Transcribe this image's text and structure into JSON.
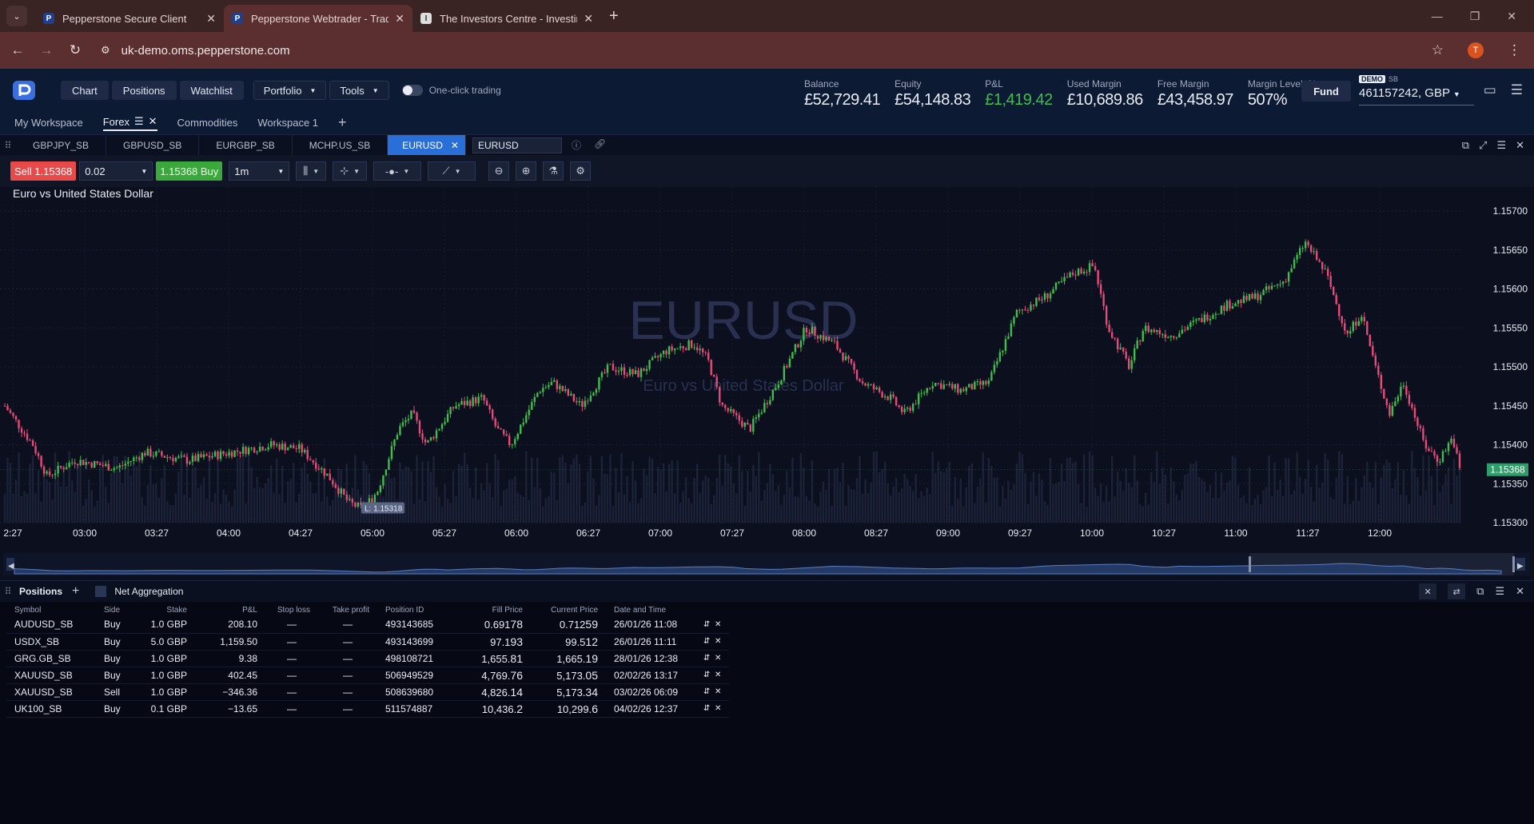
{
  "browser": {
    "tabs": [
      {
        "title": "Pepperstone Secure Client",
        "favicon": "P",
        "active": false
      },
      {
        "title": "Pepperstone Webtrader - Trade",
        "favicon": "P",
        "active": true
      },
      {
        "title": "The Investors Centre - Investing",
        "favicon": "I",
        "active": false
      }
    ],
    "url": "uk-demo.oms.pepperstone.com",
    "avatar_letter": "T"
  },
  "header": {
    "buttons": [
      "Chart",
      "Positions",
      "Watchlist"
    ],
    "selects": [
      "Portfolio",
      "Tools"
    ],
    "one_click_label": "One-click trading",
    "metrics": [
      {
        "label": "Balance",
        "value": "£52,729.41",
        "color": "#e8ecf4"
      },
      {
        "label": "Equity",
        "value": "£54,148.83",
        "color": "#e8ecf4"
      },
      {
        "label": "P&L",
        "value": "£1,419.42",
        "color": "#3fbf4a"
      },
      {
        "label": "Used Margin",
        "value": "£10,689.86",
        "color": "#e8ecf4"
      },
      {
        "label": "Free Margin",
        "value": "£43,458.97",
        "color": "#e8ecf4"
      },
      {
        "label": "Margin Level, %",
        "value": "507%",
        "color": "#e8ecf4"
      }
    ],
    "fund_label": "Fund",
    "account": {
      "badge": "DEMO",
      "type": "SB",
      "number": "461157242, GBP"
    }
  },
  "workspaces": [
    {
      "label": "My Workspace",
      "active": false
    },
    {
      "label": "Forex",
      "active": true
    },
    {
      "label": "Commodities",
      "active": false
    },
    {
      "label": "Workspace 1",
      "active": false
    }
  ],
  "symbol_tabs": [
    "GBPJPY_SB",
    "GBPUSD_SB",
    "EURGBP_SB",
    "MCHP.US_SB"
  ],
  "active_symbol": "EURUSD",
  "symbol_search_value": "EURUSD",
  "toolbar": {
    "sell_label": "Sell 1.15368",
    "quantity": "0.02",
    "buy_label": "1.15368 Buy",
    "timeframe": "1m"
  },
  "chart": {
    "title": "Euro vs United States Dollar",
    "watermark_symbol": "EURUSD",
    "watermark_name": "Euro vs United States Dollar",
    "low_label": "L: 1.15318",
    "current_price": "1.15368",
    "up_color": "#3fbf4a",
    "down_color": "#e84a7a"
  },
  "chart_data": {
    "type": "candlestick",
    "title": "Euro vs United States Dollar",
    "x_ticks": [
      "2:27",
      "03:00",
      "03:27",
      "04:00",
      "04:27",
      "05:00",
      "05:27",
      "06:00",
      "06:27",
      "07:00",
      "07:27",
      "08:00",
      "08:27",
      "09:00",
      "09:27",
      "10:00",
      "10:27",
      "11:00",
      "11:27",
      "12:00"
    ],
    "y_ticks": [
      "1.15700",
      "1.15650",
      "1.15600",
      "1.15550",
      "1.15500",
      "1.15450",
      "1.15400",
      "1.15350",
      "1.15300"
    ],
    "ylim": [
      1.153,
      1.157
    ],
    "path_points": [
      [
        0,
        1.1545
      ],
      [
        0.02,
        1.154
      ],
      [
        0.03,
        1.1536
      ],
      [
        0.05,
        1.1538
      ],
      [
        0.08,
        1.1537
      ],
      [
        0.1,
        1.1539
      ],
      [
        0.13,
        1.1538
      ],
      [
        0.16,
        1.1539
      ],
      [
        0.19,
        1.154
      ],
      [
        0.21,
        1.15395
      ],
      [
        0.23,
        1.1536
      ],
      [
        0.245,
        1.15325
      ],
      [
        0.255,
        1.15318
      ],
      [
        0.265,
        1.1534
      ],
      [
        0.28,
        1.1542
      ],
      [
        0.29,
        1.1544
      ],
      [
        0.3,
        1.154
      ],
      [
        0.32,
        1.1545
      ],
      [
        0.34,
        1.1546
      ],
      [
        0.35,
        1.1542
      ],
      [
        0.36,
        1.154
      ],
      [
        0.38,
        1.1547
      ],
      [
        0.39,
        1.1548
      ],
      [
        0.41,
        1.1545
      ],
      [
        0.43,
        1.155
      ],
      [
        0.45,
        1.1549
      ],
      [
        0.47,
        1.1552
      ],
      [
        0.49,
        1.1553
      ],
      [
        0.5,
        1.1551
      ],
      [
        0.51,
        1.1545
      ],
      [
        0.53,
        1.1542
      ],
      [
        0.55,
        1.1548
      ],
      [
        0.57,
        1.1555
      ],
      [
        0.59,
        1.1553
      ],
      [
        0.61,
        1.1548
      ],
      [
        0.63,
        1.1546
      ],
      [
        0.64,
        1.1544
      ],
      [
        0.66,
        1.1548
      ],
      [
        0.68,
        1.1547
      ],
      [
        0.7,
        1.1548
      ],
      [
        0.72,
        1.1557
      ],
      [
        0.74,
        1.1559
      ],
      [
        0.76,
        1.1562
      ],
      [
        0.775,
        1.1563
      ],
      [
        0.785,
        1.1555
      ],
      [
        0.8,
        1.155
      ],
      [
        0.81,
        1.1555
      ],
      [
        0.83,
        1.1554
      ],
      [
        0.85,
        1.1556
      ],
      [
        0.87,
        1.1558
      ],
      [
        0.89,
        1.1559
      ],
      [
        0.91,
        1.1561
      ],
      [
        0.925,
        1.1566
      ],
      [
        0.94,
        1.1562
      ],
      [
        0.955,
        1.1554
      ],
      [
        0.965,
        1.1557
      ],
      [
        0.975,
        1.155
      ],
      [
        0.985,
        1.1544
      ],
      [
        0.995,
        1.1548
      ],
      [
        1.01,
        1.154
      ],
      [
        1.02,
        1.1538
      ],
      [
        1.03,
        1.1541
      ],
      [
        1.035,
        1.15368
      ]
    ]
  },
  "positions": {
    "title": "Positions",
    "net_aggregation": "Net Aggregation",
    "columns": [
      "Symbol",
      "Side",
      "Stake",
      "P&L",
      "Stop loss",
      "Take profit",
      "Position ID",
      "Fill Price",
      "Current Price",
      "Date and Time"
    ],
    "rows": [
      {
        "symbol": "AUDUSD_SB",
        "side": "Buy",
        "stake": "1.0 GBP",
        "pnl": "208.10",
        "sl": "—",
        "tp": "—",
        "id": "493143685",
        "fill_a": "0.691",
        "fill_b": "78",
        "cur_a": "0.712",
        "cur_b": "59",
        "cur_dir": "down",
        "date": "26/01/26 11:08"
      },
      {
        "symbol": "USDX_SB",
        "side": "Buy",
        "stake": "5.0 GBP",
        "pnl": "1,159.50",
        "sl": "—",
        "tp": "—",
        "id": "493143699",
        "fill_a": "97.1",
        "fill_b": "93",
        "cur_a": "99.5",
        "cur_b": "12",
        "cur_dir": "down",
        "date": "26/01/26 11:11"
      },
      {
        "symbol": "GRG.GB_SB",
        "side": "Buy",
        "stake": "1.0 GBP",
        "pnl": "9.38",
        "sl": "—",
        "tp": "—",
        "id": "498108721",
        "fill_a": "1,655.",
        "fill_b": "81",
        "cur_a": "1,665.",
        "cur_b": "19",
        "cur_dir": "none",
        "date": "28/01/26 12:38"
      },
      {
        "symbol": "XAUUSD_SB",
        "side": "Buy",
        "stake": "1.0 GBP",
        "pnl": "402.45",
        "sl": "—",
        "tp": "—",
        "id": "506949529",
        "fill_a": "4,769.",
        "fill_b": "76",
        "cur_a": "5,173.",
        "cur_b": "05",
        "cur_dir": "up",
        "date": "02/02/26 13:17"
      },
      {
        "symbol": "XAUUSD_SB",
        "side": "Sell",
        "stake": "1.0 GBP",
        "pnl": "−346.36",
        "sl": "—",
        "tp": "—",
        "id": "508639680",
        "fill_a": "4,826.",
        "fill_b": "14",
        "cur_a": "5,173.",
        "cur_b": "34",
        "cur_dir": "up",
        "date": "03/02/26 06:09"
      },
      {
        "symbol": "UK100_SB",
        "side": "Buy",
        "stake": "0.1 GBP",
        "pnl": "−13.65",
        "sl": "—",
        "tp": "—",
        "id": "511574887",
        "fill_a": "10,436.",
        "fill_b": "2",
        "cur_a": "10,299.",
        "cur_b": "6",
        "cur_dir": "down",
        "date": "04/02/26 12:37"
      }
    ]
  }
}
